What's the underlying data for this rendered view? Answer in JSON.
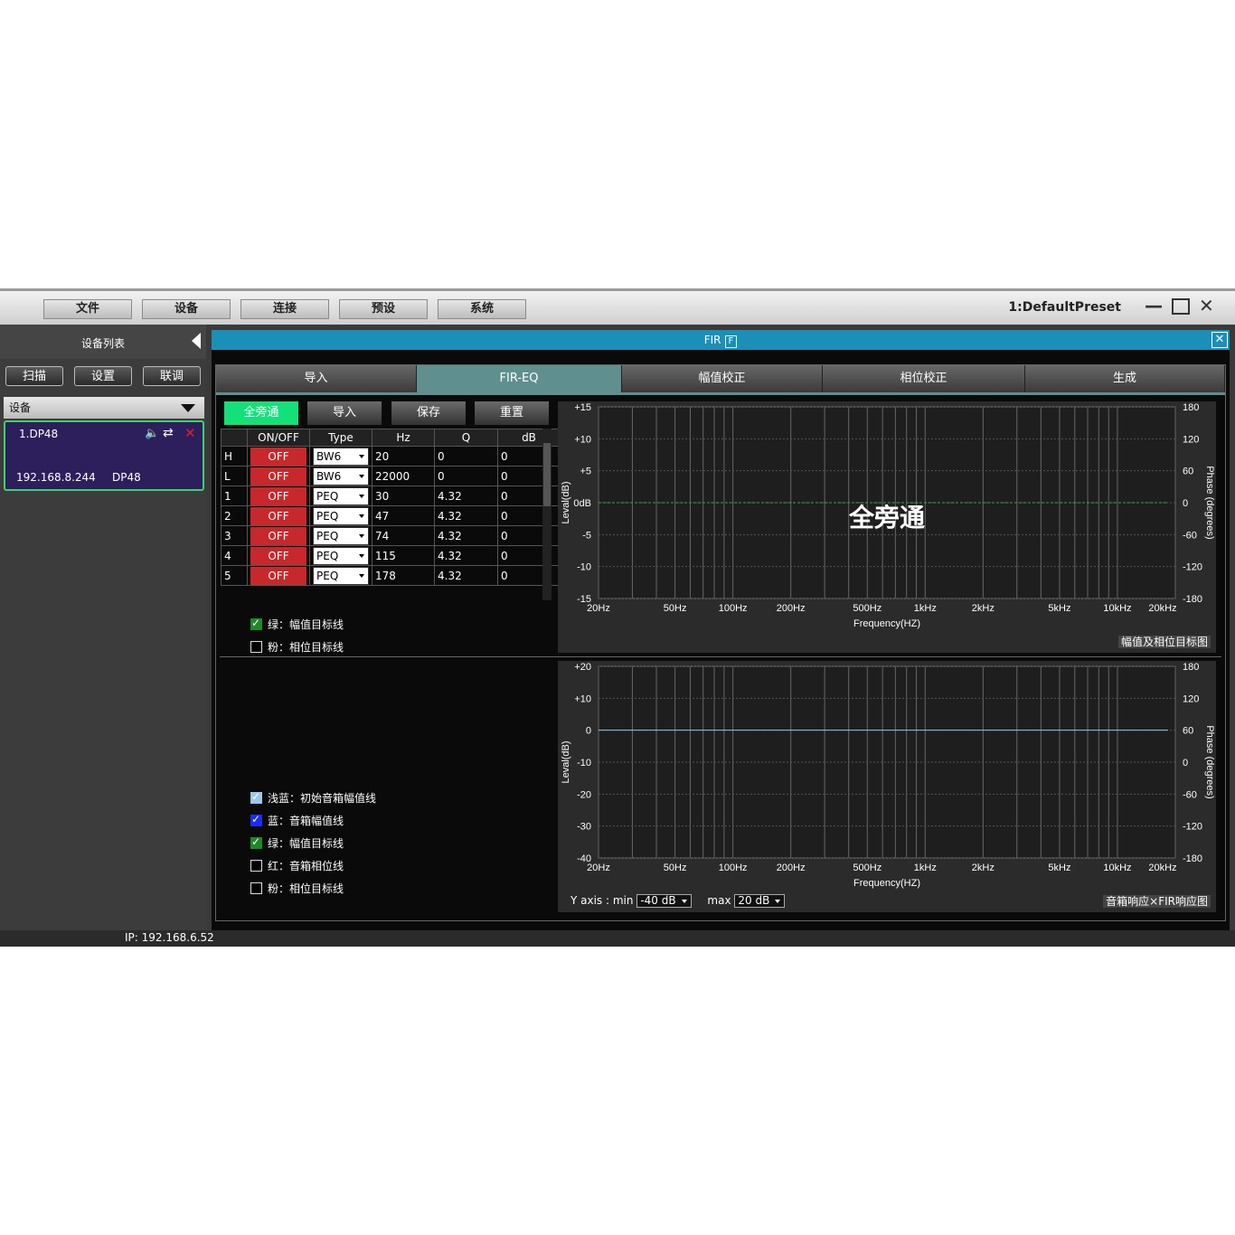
{
  "menu": [
    "文件",
    "设备",
    "连接",
    "预设",
    "系统"
  ],
  "preset": "1:DefaultPreset",
  "sidebar": {
    "title": "设备列表",
    "buttons": [
      "扫描",
      "设置",
      "联调"
    ],
    "device_header": "设备",
    "device": {
      "name": "1.DP48",
      "ip": "192.168.8.244",
      "model": "DP48"
    }
  },
  "status_ip": "IP: 192.168.6.52",
  "fir": {
    "title": "FIR",
    "badge": "F",
    "tabs": [
      "导入",
      "FIR-EQ",
      "幅值校正",
      "相位校正",
      "生成"
    ],
    "actions": [
      "全旁通",
      "导入",
      "保存",
      "重置"
    ],
    "table": {
      "headers": [
        "ON/OFF",
        "Type",
        "Hz",
        "Q",
        "dB"
      ],
      "rows": [
        {
          "id": "H",
          "state": "OFF",
          "type": "BW6",
          "hz": "20",
          "q": "0",
          "db": "0"
        },
        {
          "id": "L",
          "state": "OFF",
          "type": "BW6",
          "hz": "22000",
          "q": "0",
          "db": "0"
        },
        {
          "id": "1",
          "state": "OFF",
          "type": "PEQ",
          "hz": "30",
          "q": "4.32",
          "db": "0"
        },
        {
          "id": "2",
          "state": "OFF",
          "type": "PEQ",
          "hz": "47",
          "q": "4.32",
          "db": "0"
        },
        {
          "id": "3",
          "state": "OFF",
          "type": "PEQ",
          "hz": "74",
          "q": "4.32",
          "db": "0"
        },
        {
          "id": "4",
          "state": "OFF",
          "type": "PEQ",
          "hz": "115",
          "q": "4.32",
          "db": "0"
        },
        {
          "id": "5",
          "state": "OFF",
          "type": "PEQ",
          "hz": "178",
          "q": "4.32",
          "db": "0"
        }
      ]
    },
    "top_checks": [
      {
        "label": "绿：幅值目标线",
        "checked": true,
        "color": "green"
      },
      {
        "label": "粉：相位目标线",
        "checked": false,
        "color": "none"
      }
    ],
    "bottom_checks": [
      {
        "label": "浅蓝：初始音箱幅值线",
        "checked": true,
        "color": "light"
      },
      {
        "label": "蓝：音箱幅值线",
        "checked": true,
        "color": "blue"
      },
      {
        "label": "绿：幅值目标线",
        "checked": true,
        "color": "green"
      },
      {
        "label": "红：音箱相位线",
        "checked": false,
        "color": "none"
      },
      {
        "label": "粉：相位目标线",
        "checked": false,
        "color": "none"
      }
    ],
    "top_graph": {
      "overlay": "全旁通",
      "y_ticks": [
        "+15",
        "+10",
        "+5",
        "0dB",
        "-5",
        "-10",
        "-15"
      ],
      "phase_ticks": [
        "180",
        "120",
        "60",
        "0",
        "-60",
        "-120",
        "-180"
      ],
      "x_ticks": [
        "20Hz",
        "50Hz",
        "100Hz",
        "200Hz",
        "500Hz",
        "1kHz",
        "2kHz",
        "5kHz",
        "10kHz",
        "20kHz"
      ],
      "xlabel": "Frequency(HZ)",
      "ylabel": "Leval(dB)",
      "y2label": "Phase (degrees)",
      "caption": "幅值及相位目标图",
      "line_color": "#2fae3e"
    },
    "bottom_graph": {
      "y_ticks": [
        "+20",
        "+10",
        "0",
        "-10",
        "-20",
        "-30",
        "-40"
      ],
      "phase_ticks": [
        "180",
        "120",
        "60",
        "0",
        "-60",
        "-120",
        "-180"
      ],
      "x_ticks": [
        "20Hz",
        "50Hz",
        "100Hz",
        "200Hz",
        "500Hz",
        "1kHz",
        "2kHz",
        "5kHz",
        "10kHz",
        "20kHz"
      ],
      "xlabel": "Frequency(HZ)",
      "ylabel": "Leval(dB)",
      "y2label": "Phase (degrees)",
      "caption": "音箱响应×FIR响应图",
      "line_color": "#8fc8e8",
      "y_axis_min_label": "Y axis : min",
      "y_axis_min": "-40 dB",
      "y_axis_max_label": "max",
      "y_axis_max": "20 dB"
    }
  }
}
